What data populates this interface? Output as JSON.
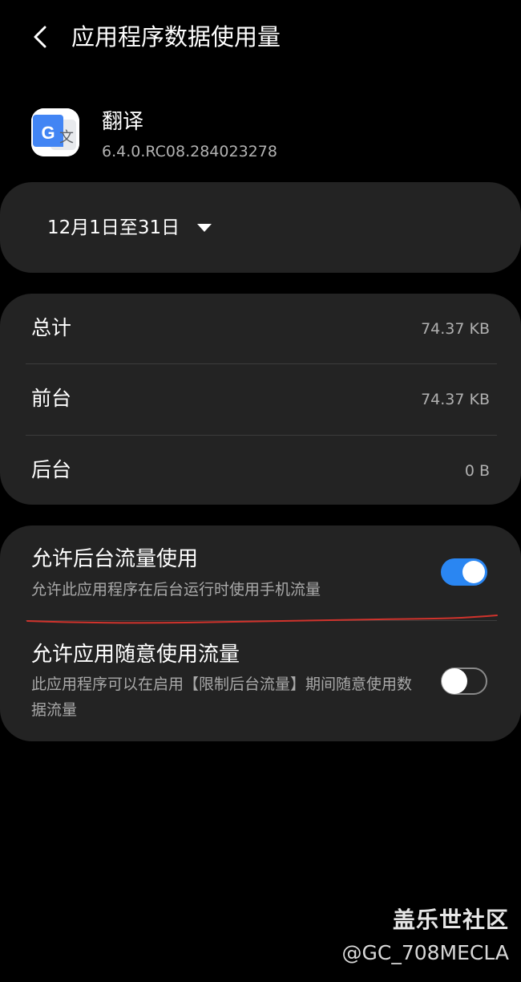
{
  "header": {
    "back_icon": "chevron-left-icon",
    "title": "应用程序数据使用量"
  },
  "app": {
    "icon": "google-translate-icon",
    "name": "翻译",
    "version": "6.4.0.RC08.284023278"
  },
  "date_range": {
    "label": "12月1日至31日",
    "dropdown_icon": "triangle-down-icon"
  },
  "usage": {
    "rows": [
      {
        "label": "总计",
        "value": "74.37 KB"
      },
      {
        "label": "前台",
        "value": "74.37 KB"
      },
      {
        "label": "后台",
        "value": "0 B"
      }
    ]
  },
  "settings": {
    "items": [
      {
        "title": "允许后台流量使用",
        "description": "允许此应用程序在后台运行时使用手机流量",
        "enabled": true
      },
      {
        "title": "允许应用随意使用流量",
        "description": "此应用程序可以在启用【限制后台流量】期间随意使用数据流量",
        "enabled": false
      }
    ]
  },
  "watermark": {
    "brand": "盖乐世社区",
    "user": "@GC_708MECLA"
  },
  "colors": {
    "background": "#000000",
    "card": "#232323",
    "accent": "#2a86f2",
    "annotation": "#d0332c"
  }
}
